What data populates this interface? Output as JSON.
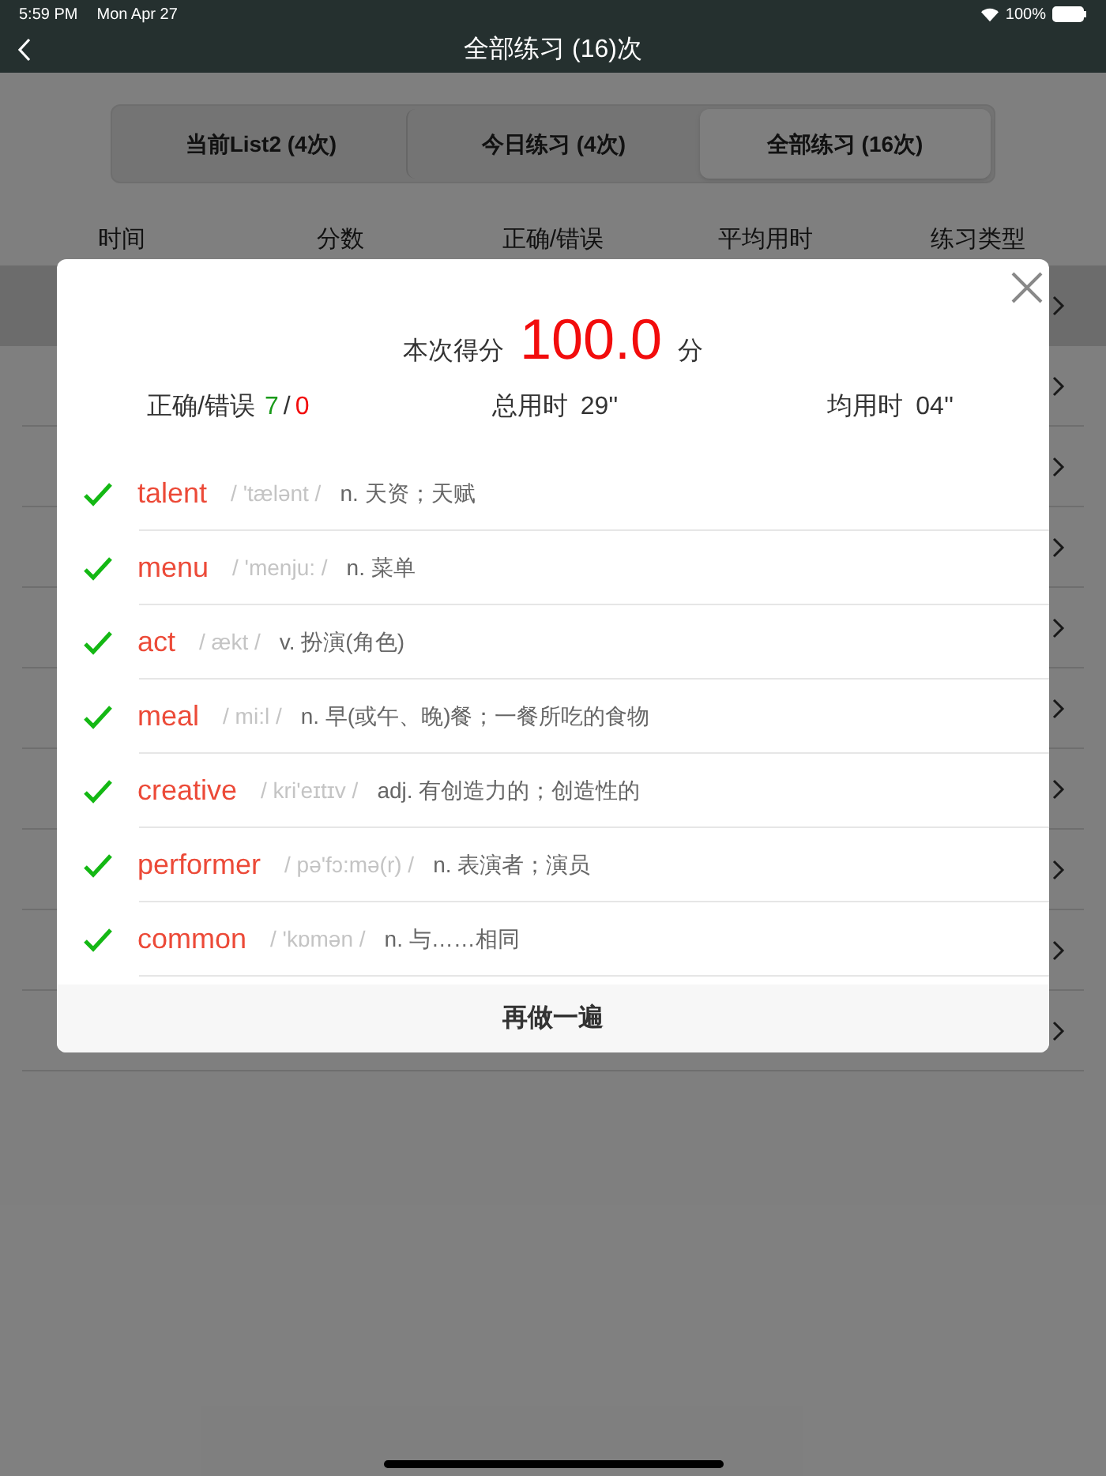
{
  "status_bar": {
    "time": "5:59 PM",
    "date": "Mon Apr 27",
    "battery": "100%"
  },
  "nav": {
    "title": "全部练习 (16)次"
  },
  "segments": [
    {
      "label": "当前List2 (4次)",
      "selected": false
    },
    {
      "label": "今日练习 (4次)",
      "selected": false
    },
    {
      "label": "全部练习 (16次)",
      "selected": true
    }
  ],
  "table": {
    "columns": [
      "时间",
      "分数",
      "正确/错误",
      "平均用时",
      "练习类型"
    ],
    "rows": [
      {
        "selected": true
      },
      {
        "selected": false
      },
      {
        "selected": false
      },
      {
        "selected": false
      },
      {
        "selected": false
      },
      {
        "selected": false
      },
      {
        "selected": false
      },
      {
        "selected": false
      },
      {
        "selected": false
      },
      {
        "selected": false
      }
    ]
  },
  "dialog": {
    "score_label": "本次得分",
    "score": "100.0",
    "score_unit": "分",
    "stats": {
      "correct_label": "正确/错误",
      "correct": "7",
      "separator": "/",
      "wrong": "0",
      "total_label": "总用时",
      "total": "29''",
      "avg_label": "均用时",
      "avg": "04''"
    },
    "words": [
      {
        "word": "talent",
        "phonetic": "/ 'tælənt /",
        "meaning": "n. 天资；天赋",
        "correct": true
      },
      {
        "word": "menu",
        "phonetic": "/ 'menju: /",
        "meaning": "n. 菜单",
        "correct": true
      },
      {
        "word": "act",
        "phonetic": "/ ækt /",
        "meaning": "v. 扮演(角色)",
        "correct": true
      },
      {
        "word": "meal",
        "phonetic": "/ mi:l /",
        "meaning": "n. 早(或午、晚)餐；一餐所吃的食物",
        "correct": true
      },
      {
        "word": "creative",
        "phonetic": "/ kri'eɪtɪv /",
        "meaning": "adj. 有创造力的；创造性的",
        "correct": true
      },
      {
        "word": "performer",
        "phonetic": "/ pə'fɔ:mə(r) /",
        "meaning": "n. 表演者；演员",
        "correct": true
      },
      {
        "word": "common",
        "phonetic": "/ 'kɒmən /",
        "meaning": "n. 与……相同",
        "correct": true
      }
    ],
    "button": "再做一遍"
  }
}
